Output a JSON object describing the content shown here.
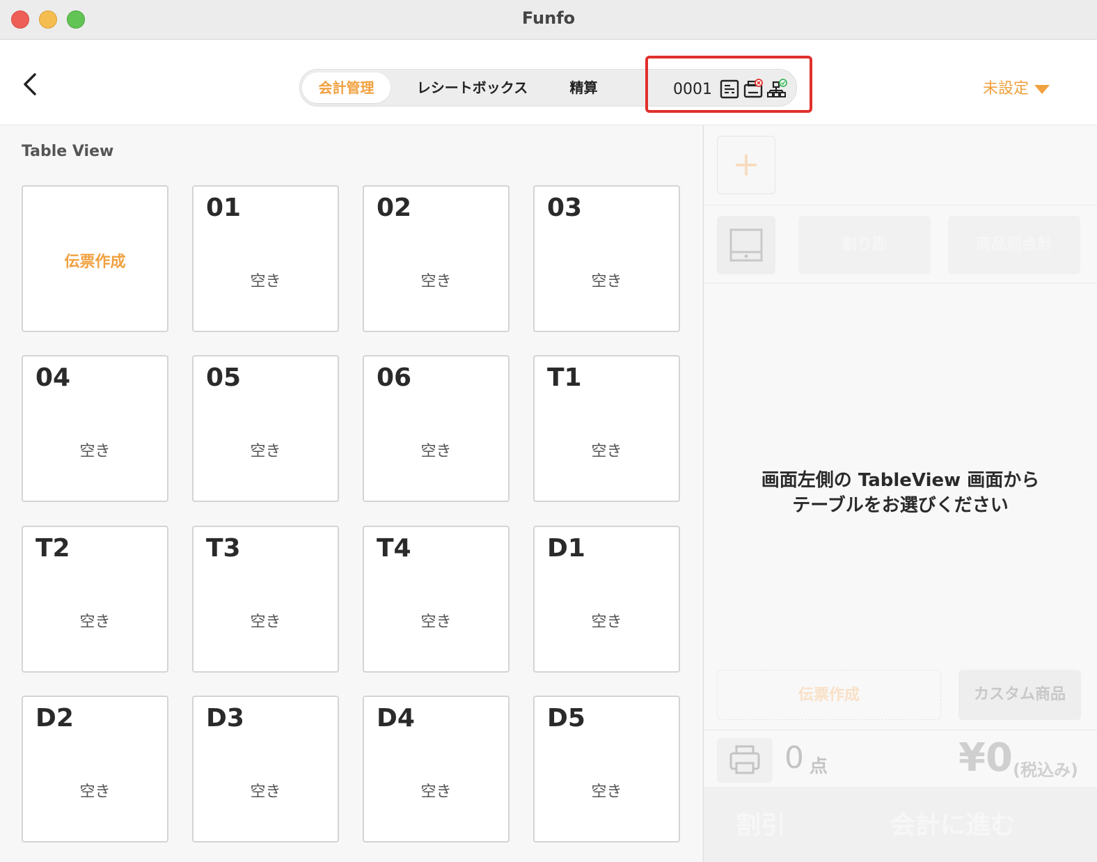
{
  "window": {
    "title": "Funfo"
  },
  "header": {
    "tabs": [
      {
        "label": "会計管理",
        "active": true
      },
      {
        "label": "レシートボックス",
        "active": false
      },
      {
        "label": "精算",
        "active": false
      }
    ],
    "device_id": "0001",
    "device_icons": [
      "receipt-icon",
      "printer-error-icon",
      "network-ok-icon"
    ],
    "status_dropdown": "未設定"
  },
  "table_view": {
    "title": "Table View",
    "create_slip_label": "伝票作成",
    "tables": [
      {
        "name": "01",
        "status": "空き"
      },
      {
        "name": "02",
        "status": "空き"
      },
      {
        "name": "03",
        "status": "空き"
      },
      {
        "name": "04",
        "status": "空き"
      },
      {
        "name": "05",
        "status": "空き"
      },
      {
        "name": "06",
        "status": "空き"
      },
      {
        "name": "T1",
        "status": "空き"
      },
      {
        "name": "T2",
        "status": "空き"
      },
      {
        "name": "T3",
        "status": "空き"
      },
      {
        "name": "T4",
        "status": "空き"
      },
      {
        "name": "D1",
        "status": "空き"
      },
      {
        "name": "D2",
        "status": "空き"
      },
      {
        "name": "D3",
        "status": "空き"
      },
      {
        "name": "D4",
        "status": "空き"
      },
      {
        "name": "D5",
        "status": "空き"
      }
    ]
  },
  "order_panel": {
    "split_label": "割り勘",
    "item_split_label": "商品別会計",
    "message_line1": "画面左側の TableView 画面から",
    "message_line2": "テーブルをお選びください",
    "create_slip_label": "伝票作成",
    "custom_item_label": "カスタム商品",
    "item_count": "0",
    "item_unit": "点",
    "total": "¥0",
    "tax_note": "(税込み)",
    "discount_label": "割引",
    "checkout_label": "会計に進む"
  },
  "colors": {
    "accent": "#f0a140",
    "highlight": "#e0302c"
  }
}
